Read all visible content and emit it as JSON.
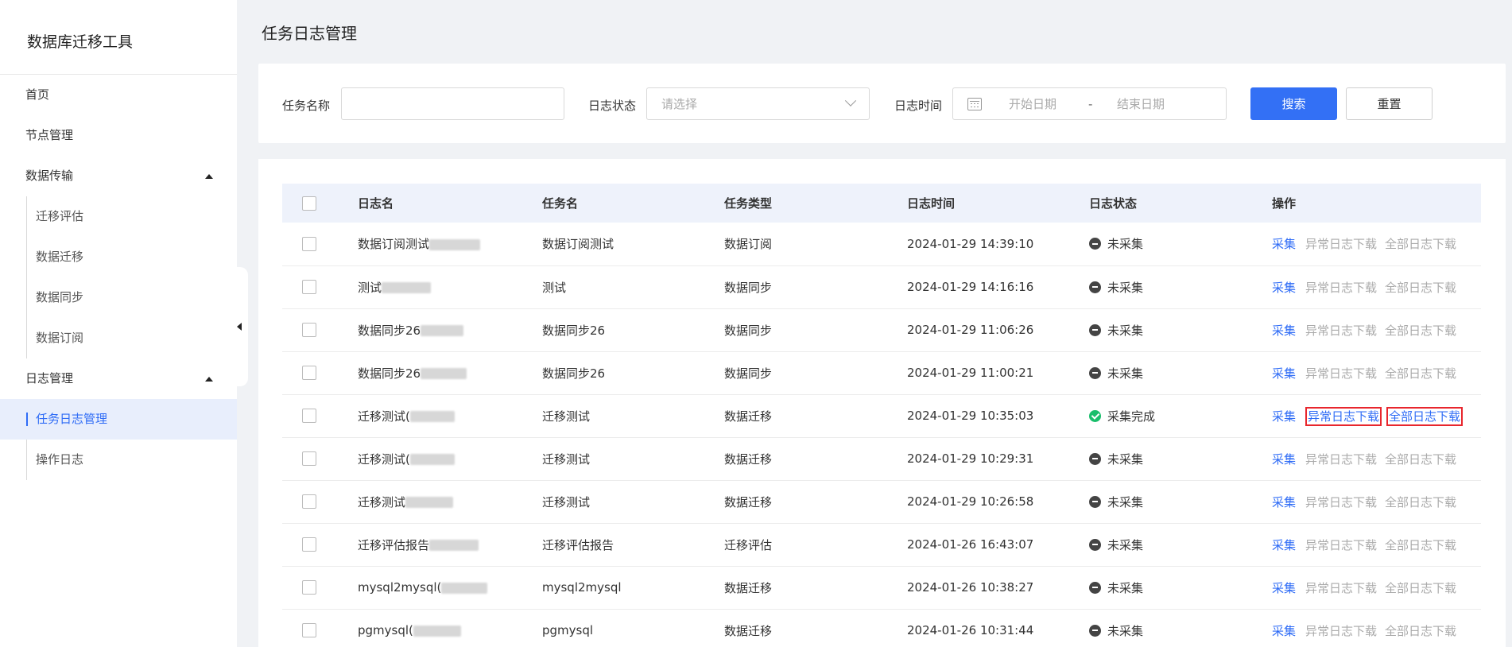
{
  "sidebar": {
    "title": "数据库迁移工具",
    "home": "首页",
    "nodes": "节点管理",
    "transfer": {
      "label": "数据传输",
      "items": [
        "迁移评估",
        "数据迁移",
        "数据同步",
        "数据订阅"
      ]
    },
    "logs": {
      "label": "日志管理",
      "items": [
        "任务日志管理",
        "操作日志"
      ]
    }
  },
  "page": {
    "title": "任务日志管理"
  },
  "filter": {
    "task_name_label": "任务名称",
    "task_name_value": "",
    "status_label": "日志状态",
    "status_placeholder": "请选择",
    "time_label": "日志时间",
    "start_placeholder": "开始日期",
    "separator": "-",
    "end_placeholder": "结束日期",
    "search": "搜索",
    "reset": "重置"
  },
  "table": {
    "headers": [
      "日志名",
      "任务名",
      "任务类型",
      "日志时间",
      "日志状态",
      "操作"
    ],
    "ops": {
      "collect": "采集",
      "error_dl": "异常日志下载",
      "all_dl": "全部日志下载"
    },
    "rows": [
      {
        "log": "数据订阅测试",
        "task": "数据订阅测试",
        "type": "数据订阅",
        "time": "2024-01-29 14:39:10",
        "status": "未采集",
        "done": false
      },
      {
        "log": "测试",
        "task": "测试",
        "type": "数据同步",
        "time": "2024-01-29 14:16:16",
        "status": "未采集",
        "done": false
      },
      {
        "log": "数据同步26",
        "task": "数据同步26",
        "type": "数据同步",
        "time": "2024-01-29 11:06:26",
        "status": "未采集",
        "done": false
      },
      {
        "log": "数据同步26",
        "task": "数据同步26",
        "type": "数据同步",
        "time": "2024-01-29 11:00:21",
        "status": "未采集",
        "done": false
      },
      {
        "log": "迁移测试(",
        "task": "迁移测试",
        "type": "数据迁移",
        "time": "2024-01-29 10:35:03",
        "status": "采集完成",
        "done": true
      },
      {
        "log": "迁移测试(",
        "task": "迁移测试",
        "type": "数据迁移",
        "time": "2024-01-29 10:29:31",
        "status": "未采集",
        "done": false
      },
      {
        "log": "迁移测试",
        "task": "迁移测试",
        "type": "数据迁移",
        "time": "2024-01-29 10:26:58",
        "status": "未采集",
        "done": false
      },
      {
        "log": "迁移评估报告",
        "task": "迁移评估报告",
        "type": "迁移评估",
        "time": "2024-01-26 16:43:07",
        "status": "未采集",
        "done": false
      },
      {
        "log": "mysql2mysql(",
        "task": "mysql2mysql",
        "type": "数据迁移",
        "time": "2024-01-26 10:38:27",
        "status": "未采集",
        "done": false
      },
      {
        "log": "pgmysql(",
        "task": "pgmysql",
        "type": "数据迁移",
        "time": "2024-01-26 10:31:44",
        "status": "未采集",
        "done": false
      }
    ]
  },
  "colors": {
    "accent": "#3370f5",
    "success": "#19be6b",
    "highlight": "#e8262d"
  }
}
